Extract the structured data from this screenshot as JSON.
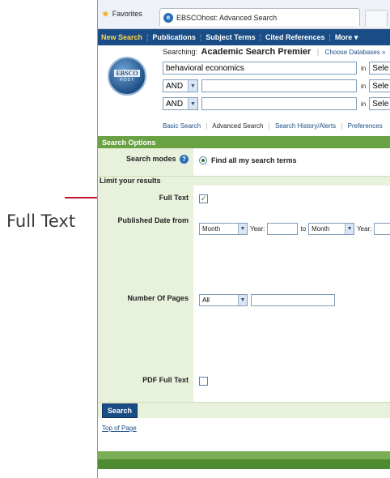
{
  "callout": {
    "label": "Full Text"
  },
  "browser": {
    "favorites_label": "Favorites",
    "tab_title": "EBSCOhost: Advanced Search"
  },
  "navbar": {
    "items": [
      "New Search",
      "Publications",
      "Subject Terms",
      "Cited References",
      "More"
    ]
  },
  "search": {
    "logo_top": "EBSCO",
    "logo_bottom": "HOST",
    "searching_label": "Searching:",
    "database": "Academic Search Premier",
    "choose_db": "Choose Databases »",
    "term1": "behavioral economics",
    "bool2": "AND",
    "bool3": "AND",
    "in_label": "in",
    "field_sel": "Sele",
    "links": [
      "Basic Search",
      "Advanced Search",
      "Search History/Alerts",
      "Preferences"
    ]
  },
  "options": {
    "header": "Search Options",
    "modes_label": "Search modes",
    "modes_value": "Find all my search terms",
    "limit_header": "Limit your results",
    "full_text_label": "Full Text",
    "full_text_checked": true,
    "published_label": "Published Date from",
    "month": "Month",
    "year_label": "Year:",
    "to_label": "to",
    "pages_label": "Number Of Pages",
    "pages_value": "All",
    "pdf_label": "PDF Full Text",
    "pdf_checked": false
  },
  "footer": {
    "search_button": "Search",
    "top_of_page": "Top of Page"
  }
}
